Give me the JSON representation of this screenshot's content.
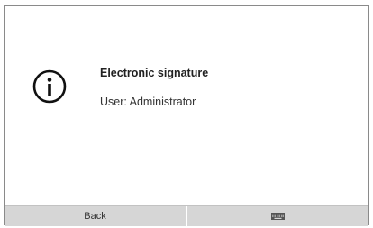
{
  "dialog": {
    "icon": "info-icon",
    "title": "Electronic signature",
    "user_text": "User: Administrator"
  },
  "footer": {
    "back_label": "Back",
    "keyboard_icon": "keyboard-icon"
  }
}
